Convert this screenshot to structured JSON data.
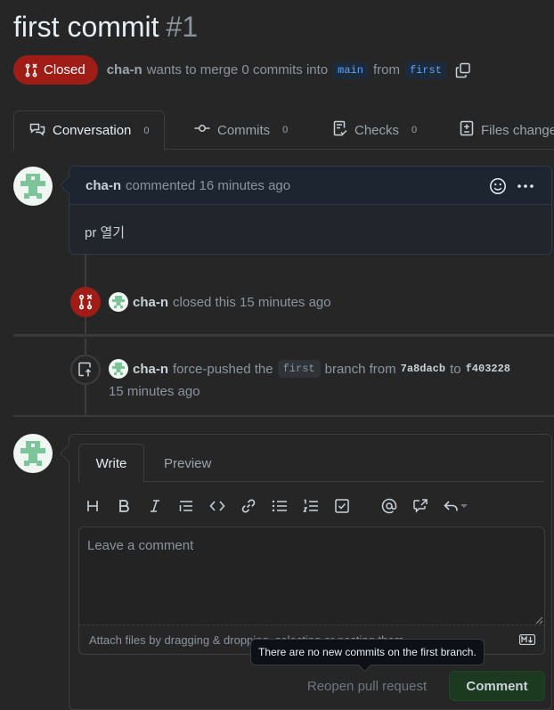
{
  "pr": {
    "title": "first commit",
    "number": "#1",
    "state": "Closed",
    "author": "cha-n",
    "summary_mid": "wants to merge 0 commits into",
    "base_branch": "main",
    "from_word": "from",
    "head_branch": "first"
  },
  "tabs": [
    {
      "label": "Conversation",
      "count": "0"
    },
    {
      "label": "Commits",
      "count": "0"
    },
    {
      "label": "Checks",
      "count": "0"
    },
    {
      "label": "Files changed",
      "count": ""
    }
  ],
  "comment": {
    "author": "cha-n",
    "action": "commented 16 minutes ago",
    "body": "pr 열기"
  },
  "events": {
    "closed": {
      "author": "cha-n",
      "text": "closed this 15 minutes ago"
    },
    "force_push": {
      "author": "cha-n",
      "text_a": "force-pushed the",
      "branch": "first",
      "text_b": "branch from",
      "from_sha": "7a8dacb",
      "to_word": "to",
      "to_sha": "f403228",
      "time": "15 minutes ago"
    }
  },
  "editor": {
    "tab_write": "Write",
    "tab_preview": "Preview",
    "placeholder": "Leave a comment",
    "attach_text": "Attach files by dragging & dropping, selecting or pasting them."
  },
  "tooltip": "There are no new commits on the first branch.",
  "buttons": {
    "reopen": "Reopen pull request",
    "comment": "Comment"
  },
  "colors": {
    "closed_badge": "#a01c17",
    "branch_blue": "#58a6ff",
    "comment_button": "#1b3a20"
  }
}
